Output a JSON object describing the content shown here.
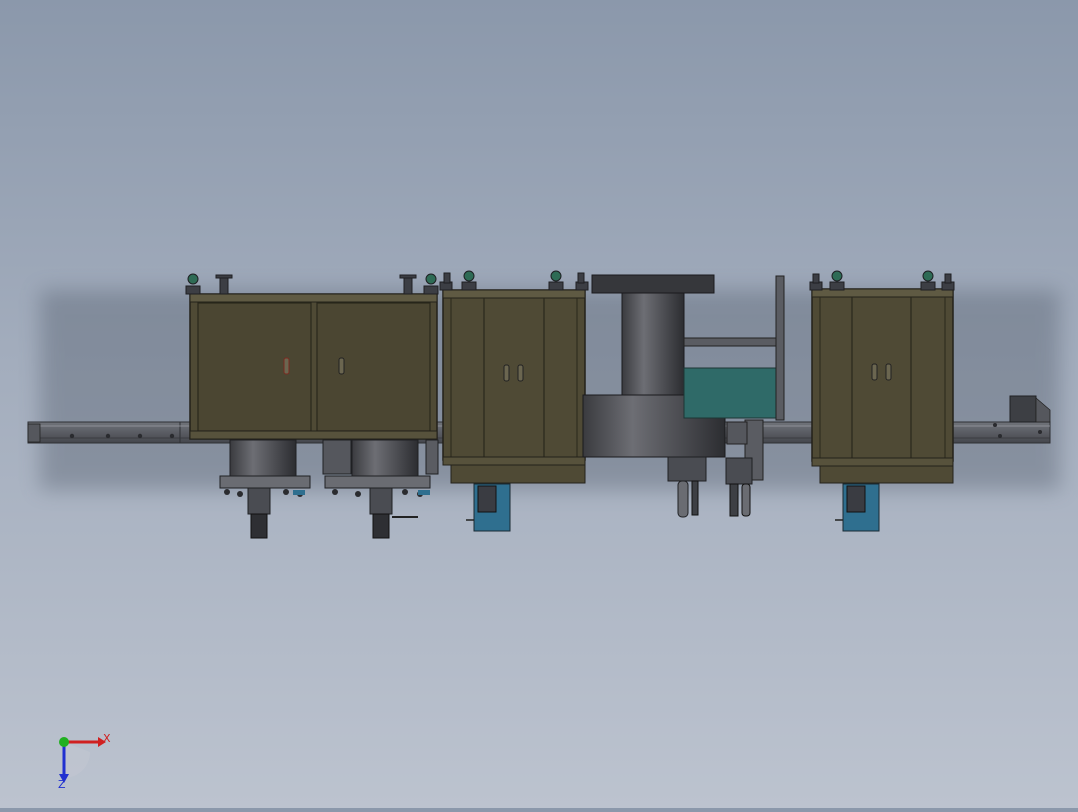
{
  "viewport": {
    "background_top": "#8b98ab",
    "background_bottom": "#bcc3cf"
  },
  "model": {
    "cabinet_color": "#4f4a35",
    "cabinet_edge": "#2a281c",
    "frame_color": "#5e6066",
    "blue_part_color": "#2f6f8f",
    "teal_panel_color": "#2f6a68"
  },
  "triad": {
    "x_label": "X",
    "z_label": "Z",
    "x_color": "#d02020",
    "y_color": "#20b020",
    "z_color": "#2030d0"
  }
}
